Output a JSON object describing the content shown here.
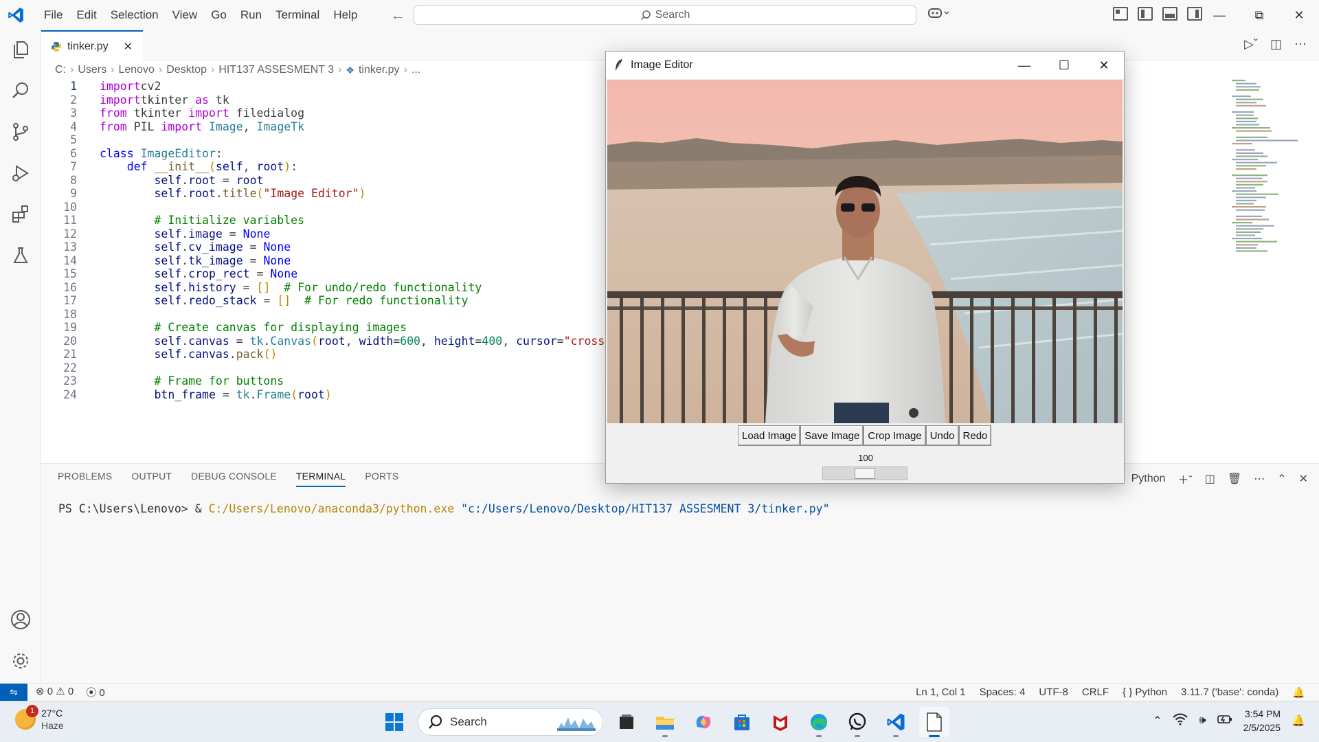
{
  "window": {
    "menu": [
      "File",
      "Edit",
      "Selection",
      "View",
      "Go",
      "Run",
      "Terminal",
      "Help"
    ],
    "search_label": "Search"
  },
  "tab": {
    "label": "tinker.py"
  },
  "breadcrumb": [
    "C:",
    "Users",
    "Lenovo",
    "Desktop",
    "HIT137 ASSESMENT 3",
    "tinker.py",
    "..."
  ],
  "editor": {
    "lines": [
      {
        "n": "1",
        "code": [
          [
            "kw",
            "import"
          ],
          [
            "",
            "cv2"
          ]
        ]
      },
      {
        "n": "2",
        "code": [
          [
            "kw",
            "import"
          ],
          [
            "",
            "tkinter "
          ],
          [
            "kw",
            "as"
          ],
          [
            "",
            " tk"
          ]
        ]
      },
      {
        "n": "3",
        "code": [
          [
            "kw",
            "from"
          ],
          [
            "",
            " tkinter "
          ],
          [
            "kw",
            "import"
          ],
          [
            "",
            " filedialog"
          ]
        ]
      },
      {
        "n": "4",
        "code": [
          [
            "kw",
            "from"
          ],
          [
            "",
            " PIL "
          ],
          [
            "kw",
            "import"
          ],
          [
            "cls",
            " Image"
          ],
          [
            "",
            ", "
          ],
          [
            "cls",
            "ImageTk"
          ]
        ]
      },
      {
        "n": "5",
        "code": []
      },
      {
        "n": "6",
        "code": [
          [
            "kw2",
            "class"
          ],
          [
            "cls",
            " ImageEditor"
          ],
          [
            "",
            ":"
          ]
        ]
      },
      {
        "n": "7",
        "code": [
          [
            "",
            "    "
          ],
          [
            "kw2",
            "def"
          ],
          [
            "fn",
            " __init__"
          ],
          [
            "p1",
            "("
          ],
          [
            "var",
            "self"
          ],
          [
            "",
            ", "
          ],
          [
            "var",
            "root"
          ],
          [
            "p1",
            ")"
          ],
          [
            "",
            ":"
          ]
        ]
      },
      {
        "n": "8",
        "code": [
          [
            "",
            "        "
          ],
          [
            "var",
            "self"
          ],
          [
            "",
            "."
          ],
          [
            "var",
            "root"
          ],
          [
            "",
            " = "
          ],
          [
            "var",
            "root"
          ]
        ]
      },
      {
        "n": "9",
        "code": [
          [
            "",
            "        "
          ],
          [
            "var",
            "self"
          ],
          [
            "",
            "."
          ],
          [
            "var",
            "root"
          ],
          [
            "",
            "."
          ],
          [
            "fn",
            "title"
          ],
          [
            "p1",
            "("
          ],
          [
            "str",
            "\"Image Editor\""
          ],
          [
            "p1",
            ")"
          ]
        ]
      },
      {
        "n": "10",
        "code": []
      },
      {
        "n": "11",
        "code": [
          [
            "",
            "        "
          ],
          [
            "cm",
            "# Initialize variables"
          ]
        ]
      },
      {
        "n": "12",
        "code": [
          [
            "",
            "        "
          ],
          [
            "var",
            "self"
          ],
          [
            "",
            "."
          ],
          [
            "var",
            "image"
          ],
          [
            "",
            " = "
          ],
          [
            "kw2",
            "None"
          ]
        ]
      },
      {
        "n": "13",
        "code": [
          [
            "",
            "        "
          ],
          [
            "var",
            "self"
          ],
          [
            "",
            "."
          ],
          [
            "var",
            "cv_image"
          ],
          [
            "",
            " = "
          ],
          [
            "kw2",
            "None"
          ]
        ]
      },
      {
        "n": "14",
        "code": [
          [
            "",
            "        "
          ],
          [
            "var",
            "self"
          ],
          [
            "",
            "."
          ],
          [
            "var",
            "tk_image"
          ],
          [
            "",
            " = "
          ],
          [
            "kw2",
            "None"
          ]
        ]
      },
      {
        "n": "15",
        "code": [
          [
            "",
            "        "
          ],
          [
            "var",
            "self"
          ],
          [
            "",
            "."
          ],
          [
            "var",
            "crop_rect"
          ],
          [
            "",
            " = "
          ],
          [
            "kw2",
            "None"
          ]
        ]
      },
      {
        "n": "16",
        "code": [
          [
            "",
            "        "
          ],
          [
            "var",
            "self"
          ],
          [
            "",
            "."
          ],
          [
            "var",
            "history"
          ],
          [
            "",
            " = "
          ],
          [
            "p1",
            "[]"
          ],
          [
            "",
            "  "
          ],
          [
            "cm",
            "# For undo/redo functionality"
          ]
        ]
      },
      {
        "n": "17",
        "code": [
          [
            "",
            "        "
          ],
          [
            "var",
            "self"
          ],
          [
            "",
            "."
          ],
          [
            "var",
            "redo_stack"
          ],
          [
            "",
            " = "
          ],
          [
            "p1",
            "[]"
          ],
          [
            "",
            "  "
          ],
          [
            "cm",
            "# For redo functionality"
          ]
        ]
      },
      {
        "n": "18",
        "code": []
      },
      {
        "n": "19",
        "code": [
          [
            "",
            "        "
          ],
          [
            "cm",
            "# Create canvas for displaying images"
          ]
        ]
      },
      {
        "n": "20",
        "code": [
          [
            "",
            "        "
          ],
          [
            "var",
            "self"
          ],
          [
            "",
            "."
          ],
          [
            "var",
            "canvas"
          ],
          [
            "",
            " = "
          ],
          [
            "cls",
            "tk"
          ],
          [
            "",
            "."
          ],
          [
            "cls",
            "Canvas"
          ],
          [
            "p1",
            "("
          ],
          [
            "var",
            "root"
          ],
          [
            "",
            ", "
          ],
          [
            "var",
            "width"
          ],
          [
            "",
            "="
          ],
          [
            "num",
            "600"
          ],
          [
            "",
            ", "
          ],
          [
            "var",
            "height"
          ],
          [
            "",
            "="
          ],
          [
            "num",
            "400"
          ],
          [
            "",
            ", "
          ],
          [
            "var",
            "cursor"
          ],
          [
            "",
            "="
          ],
          [
            "str",
            "\"cross\""
          ],
          [
            "p1",
            ")"
          ]
        ]
      },
      {
        "n": "21",
        "code": [
          [
            "",
            "        "
          ],
          [
            "var",
            "self"
          ],
          [
            "",
            "."
          ],
          [
            "var",
            "canvas"
          ],
          [
            "",
            "."
          ],
          [
            "fn",
            "pack"
          ],
          [
            "p1",
            "()"
          ]
        ]
      },
      {
        "n": "22",
        "code": []
      },
      {
        "n": "23",
        "code": [
          [
            "",
            "        "
          ],
          [
            "cm",
            "# Frame for buttons"
          ]
        ]
      },
      {
        "n": "24",
        "code": [
          [
            "",
            "        "
          ],
          [
            "var",
            "btn_frame"
          ],
          [
            "",
            " = "
          ],
          [
            "cls",
            "tk"
          ],
          [
            "",
            "."
          ],
          [
            "cls",
            "Frame"
          ],
          [
            "p1",
            "("
          ],
          [
            "var",
            "root"
          ],
          [
            "p1",
            ")"
          ]
        ]
      }
    ]
  },
  "panel": {
    "tabs": [
      "PROBLEMS",
      "OUTPUT",
      "DEBUG CONSOLE",
      "TERMINAL",
      "PORTS"
    ],
    "active_tab": "TERMINAL",
    "shell_label": "Python",
    "prompt": "PS C:\\Users\\Lenovo> ",
    "amp": "& ",
    "exe": "C:/Users/Lenovo/anaconda3/python.exe",
    "arg": " \"c:/Users/Lenovo/Desktop/HIT137 ASSESMENT 3/tinker.py\""
  },
  "statusbar": {
    "errors": "0",
    "warnings": "0",
    "ports": "0",
    "position": "Ln 1, Col 1",
    "spaces": "Spaces: 4",
    "encoding": "UTF-8",
    "eol": "CRLF",
    "language": "Python",
    "interpreter": "3.11.7 ('base': conda)"
  },
  "image_editor": {
    "title": "Image Editor",
    "buttons": [
      "Load Image",
      "Save Image",
      "Crop Image",
      "Undo",
      "Redo"
    ],
    "scale_value": "100",
    "scale_fraction": 0.5
  },
  "taskbar": {
    "weather_temp": "27°C",
    "weather_desc": "Haze",
    "weather_badge": "1",
    "search_label": "Search",
    "time": "3:54 PM",
    "date": "2/5/2025"
  },
  "colors": {
    "accent": "#005fb8",
    "kw": "#af00db",
    "kw2": "#0000ff",
    "cls": "#267f99",
    "fn": "#795e26",
    "var": "#001080",
    "str": "#a31515",
    "num": "#098658",
    "cm": "#008000",
    "p1": "#b58900",
    "exe": "#b8860b",
    "arg": "#0451a5"
  },
  "icons": [
    "vscode-logo",
    "explorer-icon",
    "search-icon",
    "source-control-icon",
    "run-debug-icon",
    "extensions-icon",
    "testing-icon",
    "accounts-icon",
    "settings-icon",
    "feather-icon",
    "windows-start-icon"
  ]
}
